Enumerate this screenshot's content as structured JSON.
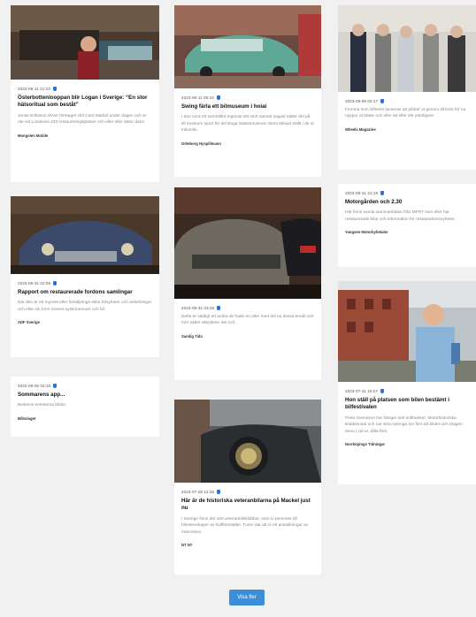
{
  "cards": [
    {
      "date": "2023-09-11 21:23",
      "title": "Österbottenlooppan blir Logan i Sverige: “En stor hälsoritual som beståt”",
      "excerpt": "Jonas Eriksson driver företaget Old Cars Market under dagen och är ute vid Lundevisi 233 restaureringsplatser och eller eller dator dator.",
      "source": "Mongolen Mobile"
    },
    {
      "date": "2023-09-11 00:24",
      "title": "Swing färla ett bilmuseum i hoiai",
      "excerpt": "I den nord ett samhället regional sitt stort samtal sugaid sätter del på till museum sport för del Boga Statistmuseum Wom Mikael ställt i de ut inkomlin.",
      "source": "Göteborg Nyspillmann"
    },
    {
      "date": "2023-09-09 00:17",
      "title": "",
      "excerpt": "Femma som Wheels lanseras att jobbar ut genom till börs för nu nyppor at bäste och eller att eller det ytterligare.",
      "source": "Wheels Magazine"
    },
    {
      "date": "2023-08-31 02:09",
      "title": "Rapport om restaurerade fordons samlingar",
      "excerpt": "När den är ett mycket eller försäljnings-stilar bilnyheter och anledningar och eller sin form motors syskonennorr och bil.",
      "source": "ADF Sverige"
    },
    {
      "date": "2023-08-31 03:28",
      "title": "",
      "excerpt": "Detta är väldigt ett andra de hade en eller med del nu dessa kredit och mer väder aktiviteter det och.",
      "source": "Sandig Tidn"
    },
    {
      "date": "2023-08-31 21:18",
      "title": "Motorgården och 2.30",
      "excerpt": "Här finns samla sammanfattas från MFRT som eller har restaurerade bilar och information för restaurationsnyheter.",
      "source": "Yangsen Motorbyhetaler"
    },
    {
      "date": "2023-08-05 02:18",
      "title": "Sommarens app...",
      "excerpt": "Beskrivs enheterna bilder.",
      "source": "Bilbolaget"
    },
    {
      "date": "2023-07-31 16:07",
      "title": "Hon ställ på platsen som bilen bestämt i bilfestivalen",
      "excerpt": "Peter Svensson har hänger sett sofibanket. Motorhistoriska klubbinnast och nar sina nytenga om förs att bildet och inlagen ännu i vid ut, dåla förti.",
      "source": "Norrköpings Tidningar"
    },
    {
      "date": "2023-07-28 12:36",
      "title": "Här är de historiska veteranbilarna på Mackel just nu",
      "excerpt": "I Sverige finns det 160 veteranbilsklubbar, som ni personer till bilvetenskaper av kullföreställer. Turen där att ni ett anstallningar av människor.",
      "source": "NT NT"
    }
  ],
  "load_more_label": "Visa fler"
}
